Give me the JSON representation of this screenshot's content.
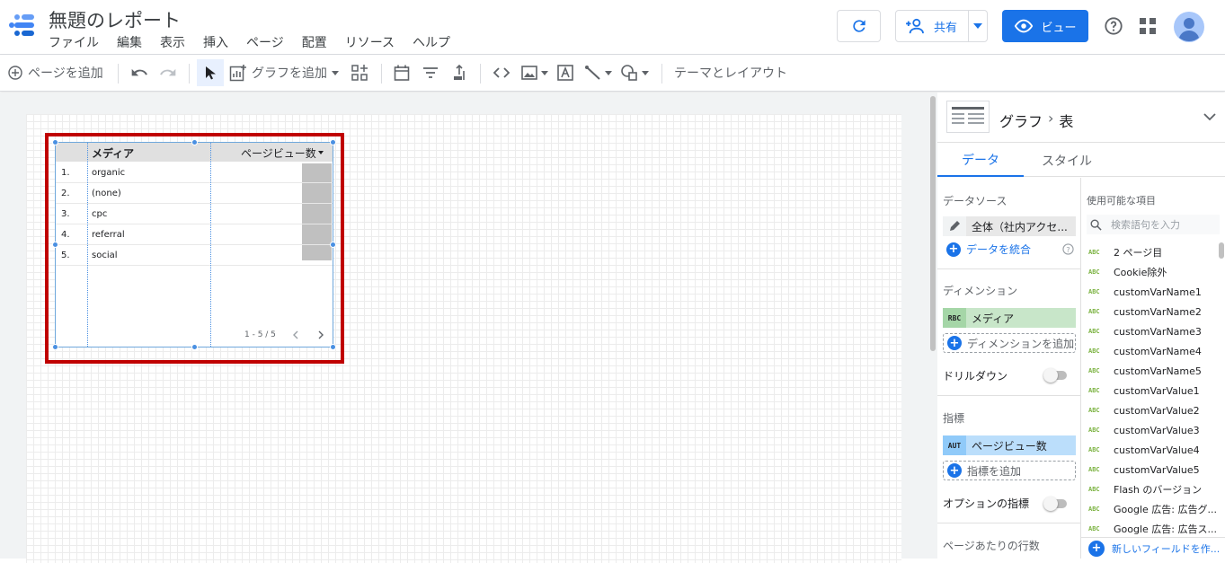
{
  "header": {
    "title": "無題のレポート",
    "menu": [
      "ファイル",
      "編集",
      "表示",
      "挿入",
      "ページ",
      "配置",
      "リソース",
      "ヘルプ"
    ],
    "share_label": "共有",
    "view_label": "ビュー"
  },
  "toolbar": {
    "add_page": "ページを追加",
    "add_chart": "グラフを追加",
    "theme_layout": "テーマとレイアウト"
  },
  "table": {
    "col_dimension": "メディア",
    "col_metric": "ページビュー数",
    "rows": [
      {
        "num": "1.",
        "value": "organic"
      },
      {
        "num": "2.",
        "value": "(none)"
      },
      {
        "num": "3.",
        "value": "cpc"
      },
      {
        "num": "4.",
        "value": "referral"
      },
      {
        "num": "5.",
        "value": "social"
      }
    ],
    "pagination": "1 - 5 / 5"
  },
  "panel": {
    "breadcrumb_parent": "グラフ",
    "breadcrumb_sep": "›",
    "breadcrumb_current": "表",
    "tabs": [
      "データ",
      "スタイル"
    ],
    "data_source_title": "データソース",
    "data_source_value": "全体（社内アクセ...",
    "blend_label": "データを統合",
    "dimension_title": "ディメンション",
    "dimension_tag": "RBC",
    "dimension_value": "メディア",
    "add_dimension": "ディメンションを追加",
    "drilldown_label": "ドリルダウン",
    "metric_title": "指標",
    "metric_tag": "AUT",
    "metric_value": "ページビュー数",
    "add_metric": "指標を追加",
    "optional_metrics": "オプションの指標",
    "rows_per_page": "ページあたりの行数",
    "available_title": "使用可能な項目",
    "search_placeholder": "検索語句を入力",
    "field_tag": "ABC",
    "fields": [
      "2 ページ目",
      "Cookie除外",
      "customVarName1",
      "customVarName2",
      "customVarName3",
      "customVarName4",
      "customVarName5",
      "customVarValue1",
      "customVarValue2",
      "customVarValue3",
      "customVarValue4",
      "customVarValue5",
      "Flash のバージョン",
      "Google 広告: 広告グ...",
      "Google 広告: 広告ス..."
    ],
    "new_field": "新しいフィールドを作..."
  },
  "colors": {
    "accent": "#1a73e8",
    "highlight": "#c00000",
    "dimension_chip": "#c8e6c9",
    "metric_chip": "#bbdefb"
  }
}
